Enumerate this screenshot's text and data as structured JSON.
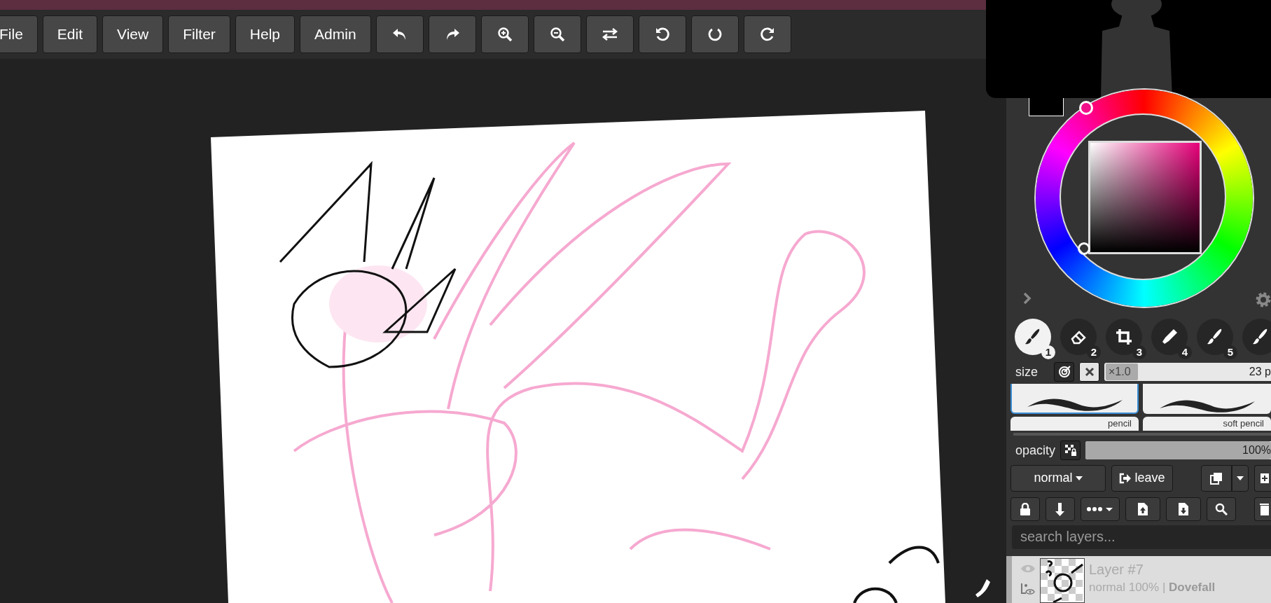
{
  "menu": [
    {
      "label": "File"
    },
    {
      "label": "Edit"
    },
    {
      "label": "View"
    },
    {
      "label": "Filter"
    },
    {
      "label": "Help"
    },
    {
      "label": "Admin"
    }
  ],
  "tools": [
    {
      "number": "1",
      "selected": true
    },
    {
      "number": "2",
      "selected": false
    },
    {
      "number": "3",
      "selected": false
    },
    {
      "number": "4",
      "selected": false
    },
    {
      "number": "5",
      "selected": false
    }
  ],
  "size": {
    "label": "size",
    "multiplier": "×1.0",
    "value": "23 p"
  },
  "brushes": [
    {
      "name": "pencil",
      "selected": true
    },
    {
      "name": "soft pencil",
      "selected": false
    }
  ],
  "opacity": {
    "label": "opacity",
    "value": "100%",
    "level": 1
  },
  "blend_mode": "normal",
  "leave": "leave",
  "search": {
    "placeholder": "search layers..."
  },
  "layer": {
    "name": "Layer #7",
    "info": "normal 100% | **Dovefall**"
  }
}
